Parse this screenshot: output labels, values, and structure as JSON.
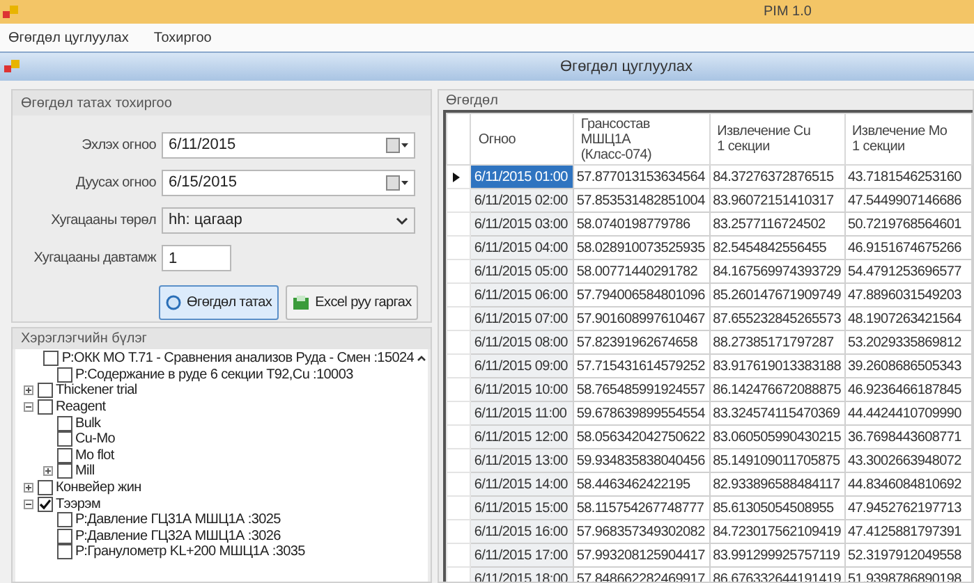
{
  "window": {
    "title": "PIM 1.0"
  },
  "menu": [
    "Өгөгдөл цуглуулах",
    "Тохиргоо"
  ],
  "form_title": "Өгөгдөл цуглуулах",
  "settings": {
    "title": "Өгөгдөл татах тохиргоо",
    "fields": [
      {
        "kind": "date",
        "label": "Эхлэх огноо",
        "value": "6/11/2015"
      },
      {
        "kind": "date",
        "label": "Дуусах огноо",
        "value": "6/15/2015"
      },
      {
        "kind": "select",
        "label": "Хугацааны төрөл",
        "value": "hh: цагаар"
      },
      {
        "kind": "text",
        "label": "Хугацааны давтамж",
        "value": "1"
      }
    ],
    "buttons": [
      {
        "label": "Өгөгдөл татах",
        "kind": "fetch",
        "focused": true
      },
      {
        "label": "Excel руу гаргах",
        "kind": "excel",
        "focused": false
      }
    ]
  },
  "tree": {
    "title": "Хэрэглэгчийн бүлэг",
    "continued": [
      {
        "label": "Р:ОКК МО Т.71 - Сравнения анализов Руда - Смен :15024",
        "checked": false
      },
      {
        "label": "Р:Содержание в руде 6 секции Т92,Cu :10003",
        "checked": false
      }
    ],
    "nodes": [
      {
        "label": "Thickener trial",
        "checked": false,
        "expanded": false
      },
      {
        "label": "Reagent",
        "checked": false,
        "expanded": true,
        "children": [
          {
            "label": "Bulk",
            "checked": false
          },
          {
            "label": "Cu-Mo",
            "checked": false
          },
          {
            "label": "Mo flot",
            "checked": false
          },
          {
            "label": "Mill",
            "checked": false,
            "expanded": false
          }
        ]
      },
      {
        "label": "Конвейер жин",
        "checked": false,
        "expanded": false
      },
      {
        "label": "Тээрэм",
        "checked": true,
        "expanded": true,
        "children": [
          {
            "label": "Р:Давление ГЦ31А  МШЦ1А :3025",
            "checked": false
          },
          {
            "label": "Р:Давление ГЦ32А  МШЦ1А :3026",
            "checked": false
          },
          {
            "label": "Р:Гранулометр KL+200 МШЦ1А :3035",
            "checked": false
          }
        ]
      }
    ]
  },
  "grid": {
    "title": "Өгөгдөл",
    "columns": [
      "Огноо",
      "Грансостав\nМШЦ1А\n(Класс-074)",
      "Извлечение Cu\n1 секции",
      "Извлечение Mo\n1 секции"
    ],
    "rows": [
      {
        "current": true,
        "cells": [
          "6/11/2015 01:00",
          "57.877013153634564",
          "84.37276372876515",
          "43.7181546253160"
        ]
      },
      {
        "current": false,
        "cells": [
          "6/11/2015 02:00",
          "57.853531482851004",
          "83.96072151410317",
          "47.5449907146686"
        ]
      },
      {
        "current": false,
        "cells": [
          "6/11/2015 03:00",
          "58.0740198779786",
          "83.2577116724502",
          "50.7219768564601"
        ]
      },
      {
        "current": false,
        "cells": [
          "6/11/2015 04:00",
          "58.028910073525935",
          "82.5454842556455",
          "46.9151674675266"
        ]
      },
      {
        "current": false,
        "cells": [
          "6/11/2015 05:00",
          "58.00771440291782",
          "84.167569974393729",
          "54.4791253696577"
        ]
      },
      {
        "current": false,
        "cells": [
          "6/11/2015 06:00",
          "57.794006584801096",
          "85.260147671909749",
          "47.8896031549203"
        ]
      },
      {
        "current": false,
        "cells": [
          "6/11/2015 07:00",
          "57.901608997610467",
          "87.655232845265573",
          "48.1907263421564"
        ]
      },
      {
        "current": false,
        "cells": [
          "6/11/2015 08:00",
          "57.82391962674658",
          "88.27385171797287",
          "53.2029335869812"
        ]
      },
      {
        "current": false,
        "cells": [
          "6/11/2015 09:00",
          "57.715431614579252",
          "83.917619013383188",
          "39.2608686505343"
        ]
      },
      {
        "current": false,
        "cells": [
          "6/11/2015 10:00",
          "58.765485991924557",
          "86.142476672088875",
          "46.9236466187845"
        ]
      },
      {
        "current": false,
        "cells": [
          "6/11/2015 11:00",
          "59.678639899554554",
          "83.324574115470369",
          "44.4424410709990"
        ]
      },
      {
        "current": false,
        "cells": [
          "6/11/2015 12:00",
          "58.056342042750622",
          "83.060505990430215",
          "36.7698443608771"
        ]
      },
      {
        "current": false,
        "cells": [
          "6/11/2015 13:00",
          "59.934835838040456",
          "85.149109011705875",
          "43.3002663948072"
        ]
      },
      {
        "current": false,
        "cells": [
          "6/11/2015 14:00",
          "58.4463462422195",
          "82.933896588484117",
          "44.8346084810692"
        ]
      },
      {
        "current": false,
        "cells": [
          "6/11/2015 15:00",
          "58.115754267748777",
          "85.61305054508955",
          "47.9452762197713"
        ]
      },
      {
        "current": false,
        "cells": [
          "6/11/2015 16:00",
          "57.968357349302082",
          "84.723017562109419",
          "47.4125881797391"
        ]
      },
      {
        "current": false,
        "cells": [
          "6/11/2015 17:00",
          "57.993208125904417",
          "83.991299925757119",
          "52.3197912049558"
        ]
      },
      {
        "current": false,
        "cells": [
          "6/11/2015 18:00",
          "57.848662282469917",
          "86.676332644191419",
          "51.9398786890198"
        ]
      }
    ]
  }
}
